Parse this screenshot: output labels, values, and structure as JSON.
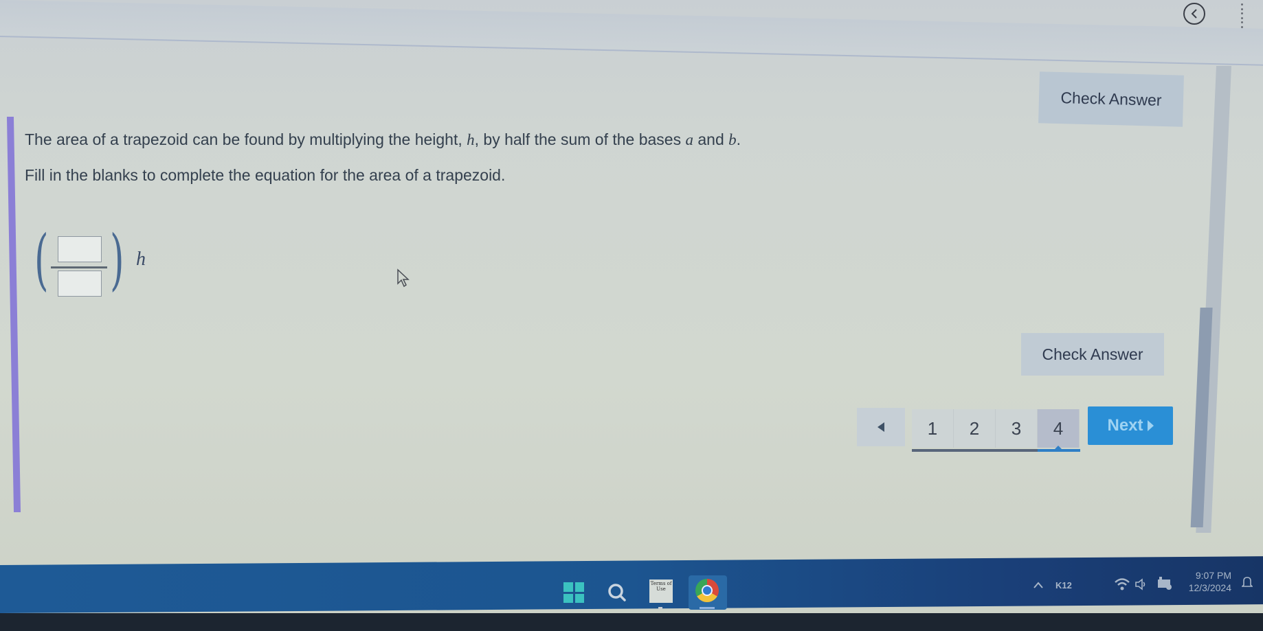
{
  "header": {
    "back_button_label": "Back",
    "menu_label": "More options"
  },
  "question": {
    "paragraph1": {
      "pre": "The area of a trapezoid can be found by multiplying the height, ",
      "var_h": "h",
      "mid": ", by half the sum of the bases ",
      "var_a": "a",
      "and": " and ",
      "var_b": "b",
      "end": "."
    },
    "paragraph2": "Fill in the blanks to complete the equation for the area of a trapezoid.",
    "equation": {
      "numerator_value": "",
      "denominator_value": "",
      "trailing_variable": "h"
    }
  },
  "buttons": {
    "check_answer_top": "Check Answer",
    "check_answer_bottom": "Check Answer",
    "next": "Next"
  },
  "pagination": {
    "pages": [
      "1",
      "2",
      "3",
      "4"
    ],
    "current_page": 4,
    "prev_icon": "triangle-left-icon",
    "next_icon": "triangle-right-icon"
  },
  "taskbar": {
    "apps": [
      {
        "name": "Start",
        "icon": "windows-start-icon"
      },
      {
        "name": "Search",
        "icon": "search-icon"
      },
      {
        "name": "Terms of Use",
        "icon": "terms-of-use-icon",
        "label": "Terms of Use"
      },
      {
        "name": "Google Chrome",
        "icon": "chrome-icon"
      }
    ],
    "tray": {
      "k12_label": "K12",
      "time": "9:07 PM",
      "date": "12/3/2024"
    }
  },
  "colors": {
    "accent_purple": "#8b7fd6",
    "next_button": "#2a8fd6",
    "check_button": "#b9c6d2",
    "taskbar": "#1e5a96"
  }
}
